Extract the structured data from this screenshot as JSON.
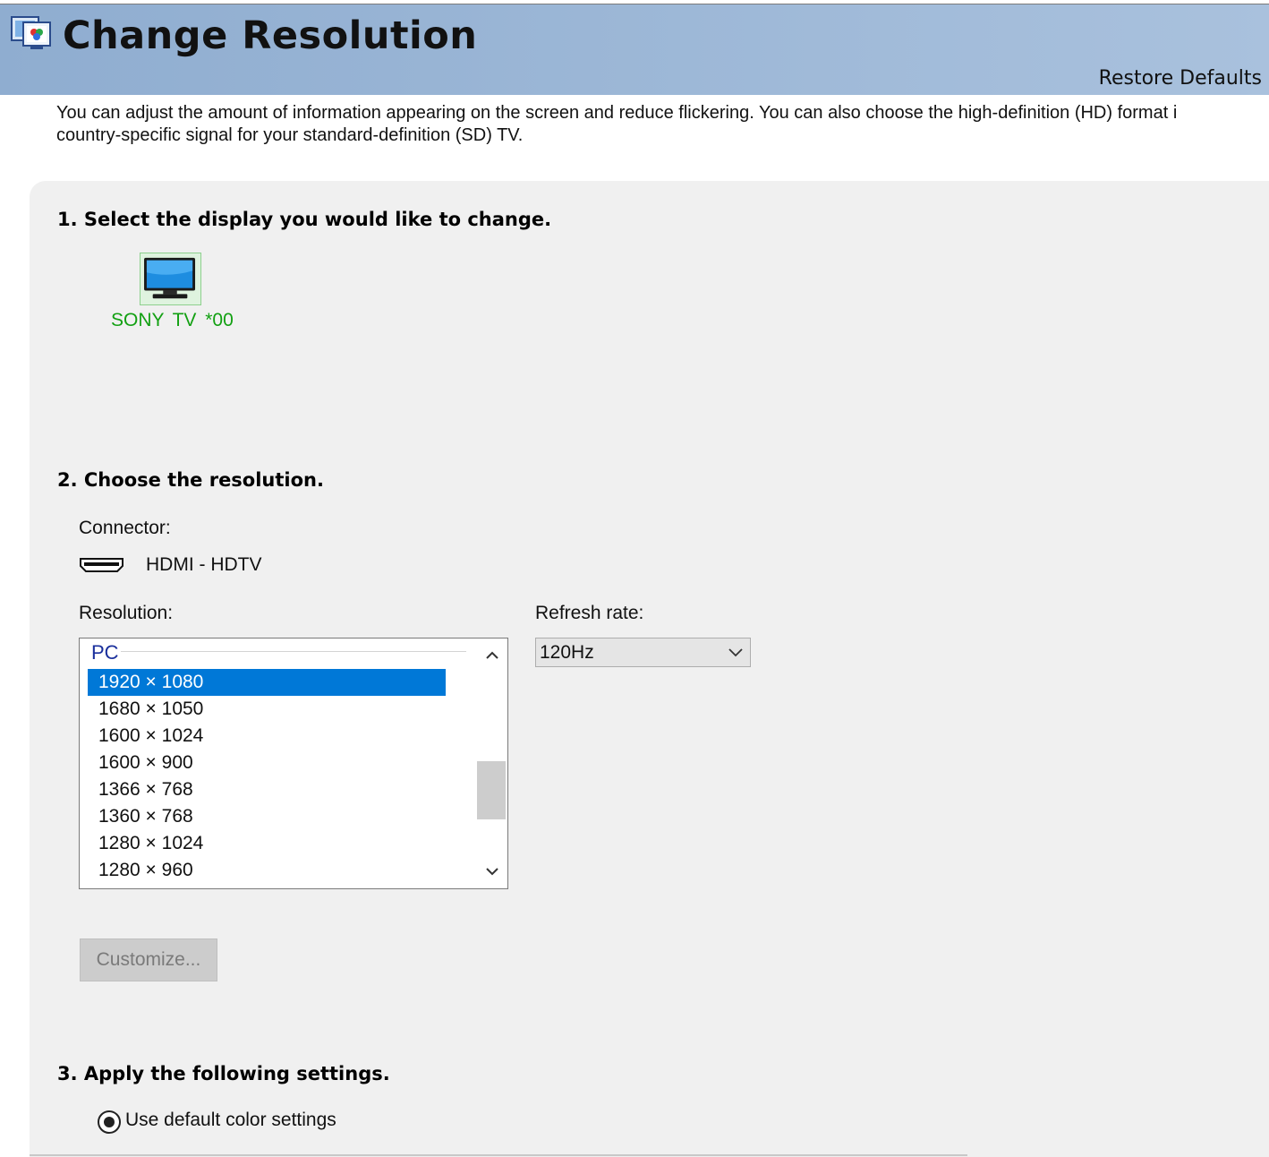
{
  "header": {
    "title": "Change Resolution",
    "restore_defaults": "Restore Defaults",
    "icon": "display-properties-icon"
  },
  "description": {
    "line1": "You can adjust the amount of information appearing on the screen and reduce flickering. You can also choose the high-definition (HD) format i",
    "line2": "country-specific signal for your standard-definition (SD) TV."
  },
  "section1": {
    "heading": "1. Select the display you would like to change.",
    "display": {
      "label": "SONY TV  *00",
      "icon": "tv-monitor-icon",
      "selected": true
    }
  },
  "section2": {
    "heading": "2. Choose the resolution.",
    "connector_label": "Connector:",
    "connector_icon": "hdmi-connector-icon",
    "connector_value": "HDMI - HDTV",
    "resolution_label": "Resolution:",
    "resolution_group": "PC",
    "resolutions": [
      "1920 × 1080",
      "1680 × 1050",
      "1600 × 1024",
      "1600 × 900",
      "1366 × 768",
      "1360 × 768",
      "1280 × 1024",
      "1280 × 960"
    ],
    "selected_resolution": "1920 × 1080",
    "refresh_label": "Refresh rate:",
    "refresh_value": "120Hz",
    "customize_button": "Customize..."
  },
  "section3": {
    "heading": "3. Apply the following settings.",
    "radio_label": "Use default color settings",
    "radio_checked": true
  },
  "colors": {
    "header_bg": "#a2bad8",
    "panel_bg": "#f0f0f0",
    "selection": "#0078d7",
    "display_label": "#12a012",
    "group_label": "#1a2f9c"
  }
}
